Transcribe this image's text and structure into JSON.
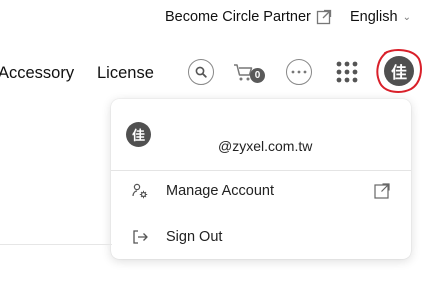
{
  "topbar": {
    "partner_label": "Become Circle Partner",
    "language_label": "English"
  },
  "nav": {
    "items": [
      {
        "label": "Accessory"
      },
      {
        "label": "License"
      }
    ]
  },
  "header_icons": {
    "cart_count": "0",
    "avatar_initial": "佳"
  },
  "account_menu": {
    "avatar_initial": "佳",
    "email": "@zyxel.com.tw",
    "manage_account_label": "Manage Account",
    "sign_out_label": "Sign Out"
  },
  "colors": {
    "avatar_bg": "#505050",
    "highlight_ring": "#d9202a",
    "icon_gray": "#888888"
  }
}
